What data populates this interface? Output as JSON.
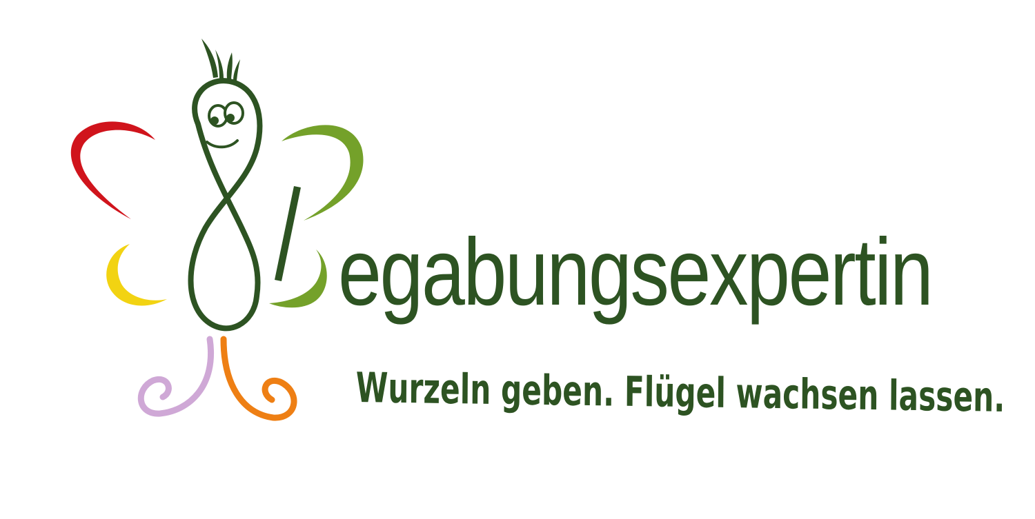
{
  "brand": {
    "wordmark": "egabungsexpertin",
    "tagline": "Wurzeln geben. Flügel wachsen lassen."
  },
  "colors": {
    "text": "#2d5322",
    "body_stroke": "#2d5322",
    "wing_top_left": "#d0141c",
    "wing_top_right": "#74a12a",
    "wing_bottom_left": "#f2d312",
    "wing_bottom_right": "#74a12a",
    "antenna": "#2d5322",
    "leg_left": "#cfa8d6",
    "leg_right": "#ee7f14"
  },
  "icons": {
    "mark": "butterfly-mascot-icon"
  }
}
